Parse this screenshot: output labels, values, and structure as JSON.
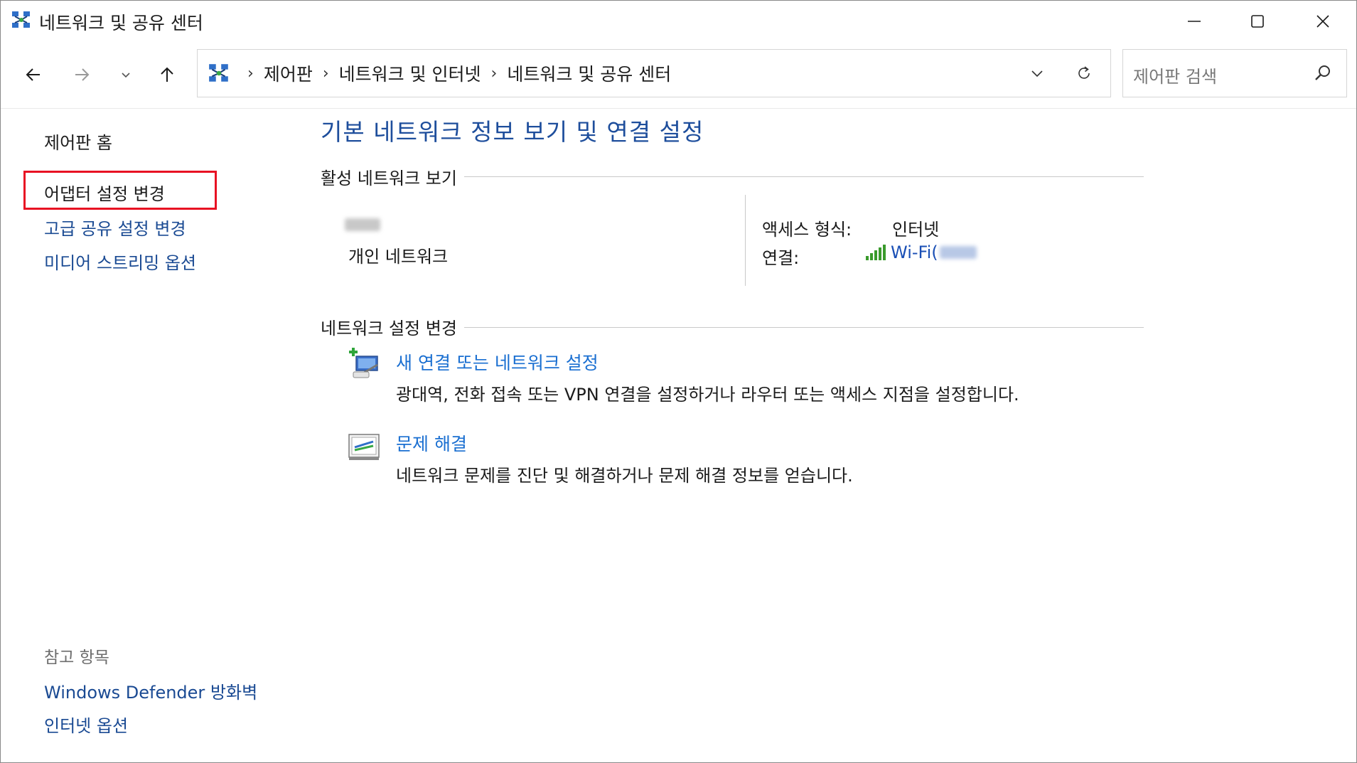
{
  "window": {
    "title": "네트워크 및 공유 센터"
  },
  "nav": {
    "breadcrumbs": [
      "제어판",
      "네트워크 및 인터넷",
      "네트워크 및 공유 센터"
    ],
    "breadcrumb_sep": "›",
    "search_placeholder": "제어판 검색"
  },
  "sidebar": {
    "home": "제어판 홈",
    "links": [
      "어댑터 설정 변경",
      "고급 공유 설정 변경",
      "미디어 스트리밍 옵션"
    ],
    "see_also_heading": "참고 항목",
    "see_also": [
      "Windows Defender 방화벽",
      "인터넷 옵션"
    ]
  },
  "main": {
    "title": "기본 네트워크 정보 보기 및 연결 설정",
    "active_networks_heading": "활성 네트워크 보기",
    "network_type": "개인 네트워크",
    "access_type_label": "액세스 형식:",
    "access_type_value": "인터넷",
    "connection_label": "연결:",
    "connection_value": "Wi-Fi(",
    "change_settings_heading": "네트워크 설정 변경",
    "tasks": [
      {
        "title": "새 연결 또는 네트워크 설정",
        "description": "광대역, 전화 접속 또는 VPN 연결을 설정하거나 라우터 또는 액세스 지점을 설정합니다."
      },
      {
        "title": "문제 해결",
        "description": "네트워크 문제를 진단 및 해결하거나 문제 해결 정보를 얻습니다."
      }
    ]
  },
  "colors": {
    "link": "#1a4a93",
    "task_link": "#1a6fd1",
    "title": "#1e4e9c",
    "highlight": "#e81123",
    "wifi_bars": "#3a9a2c"
  },
  "icons": [
    "network-center-icon",
    "back-arrow-icon",
    "forward-arrow-icon",
    "recent-chevron-icon",
    "up-arrow-icon",
    "dropdown-chevron-icon",
    "refresh-icon",
    "search-icon",
    "minimize-icon",
    "maximize-icon",
    "close-icon",
    "wifi-signal-icon",
    "new-connection-icon",
    "troubleshoot-icon"
  ]
}
